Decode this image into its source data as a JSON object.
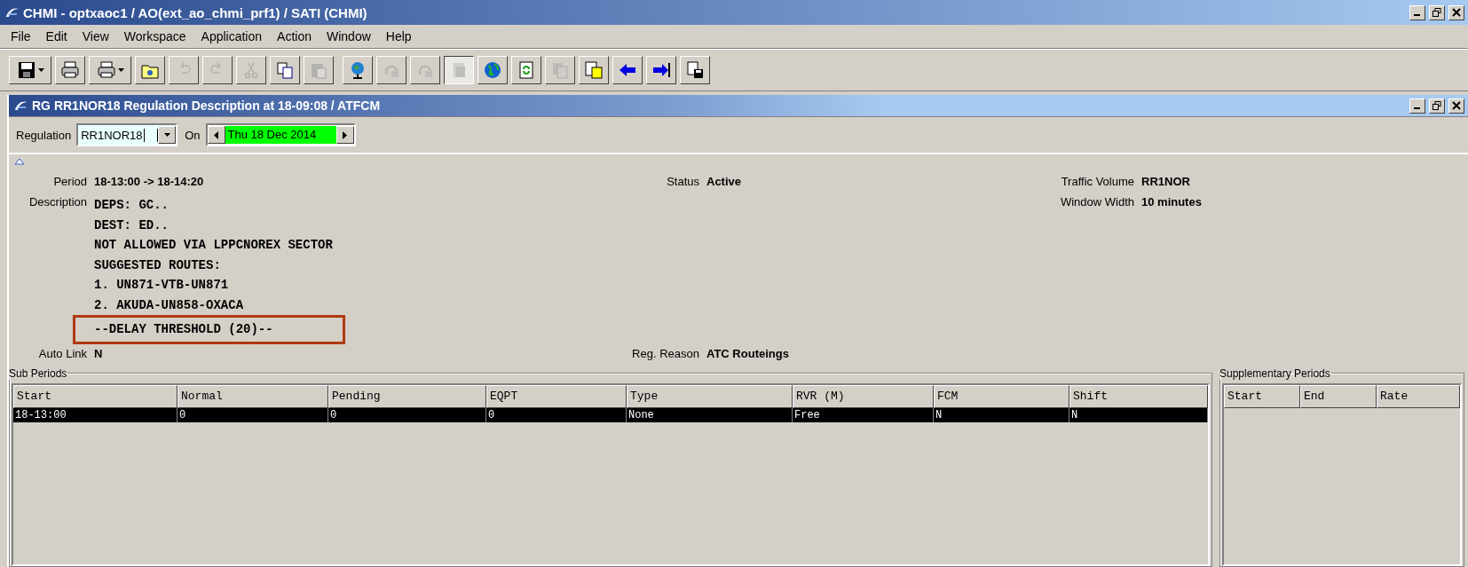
{
  "window": {
    "title": "CHMI - optxaoc1 / AO(ext_ao_chmi_prf1) / SATI (CHMI)"
  },
  "menu": [
    "File",
    "Edit",
    "View",
    "Workspace",
    "Application",
    "Action",
    "Window",
    "Help"
  ],
  "toolbar": [
    {
      "kind": "save",
      "disabled": false,
      "dropdown": true,
      "pressed": false
    },
    {
      "kind": "print",
      "disabled": false,
      "dropdown": false,
      "pressed": false
    },
    {
      "kind": "print",
      "disabled": false,
      "dropdown": true,
      "pressed": false
    },
    {
      "kind": "folder",
      "disabled": false,
      "dropdown": false,
      "pressed": false
    },
    {
      "kind": "undo",
      "disabled": true,
      "dropdown": false,
      "pressed": false
    },
    {
      "kind": "redo",
      "disabled": true,
      "dropdown": false,
      "pressed": false
    },
    {
      "kind": "cut",
      "disabled": true,
      "dropdown": false,
      "pressed": false
    },
    {
      "kind": "copy",
      "disabled": false,
      "dropdown": false,
      "pressed": false
    },
    {
      "kind": "paste",
      "disabled": true,
      "dropdown": false,
      "pressed": false
    },
    {
      "kind": "globe",
      "disabled": false,
      "dropdown": false,
      "pressed": false
    },
    {
      "kind": "rotate",
      "disabled": true,
      "dropdown": false,
      "pressed": false
    },
    {
      "kind": "rotate",
      "disabled": true,
      "dropdown": false,
      "pressed": false
    },
    {
      "kind": "doc",
      "disabled": true,
      "dropdown": false,
      "pressed": true
    },
    {
      "kind": "earth",
      "disabled": false,
      "dropdown": false,
      "pressed": false
    },
    {
      "kind": "reload",
      "disabled": false,
      "dropdown": false,
      "pressed": false
    },
    {
      "kind": "docs",
      "disabled": true,
      "dropdown": false,
      "pressed": false
    },
    {
      "kind": "notes",
      "disabled": false,
      "dropdown": false,
      "pressed": false
    },
    {
      "kind": "left",
      "disabled": false,
      "dropdown": false,
      "pressed": false
    },
    {
      "kind": "right",
      "disabled": false,
      "dropdown": false,
      "pressed": false
    },
    {
      "kind": "savedoc",
      "disabled": false,
      "dropdown": false,
      "pressed": false
    }
  ],
  "inner_window": {
    "title": "RG RR1NOR18 Regulation Description at 18-09:08 / ATFCM"
  },
  "form": {
    "regulation_label": "Regulation",
    "regulation_value": "RR1NOR18",
    "on_label": "On",
    "date": "Thu 18 Dec 2014"
  },
  "details": {
    "period_label": "Period",
    "period": "18-13:00 -> 18-14:20",
    "status_label": "Status",
    "status": "Active",
    "traffic_volume_label": "Traffic Volume",
    "traffic_volume": "RR1NOR",
    "window_width_label": "Window Width",
    "window_width": "10 minutes",
    "description_label": "Description",
    "description": [
      "DEPS: GC..",
      "DEST: ED..",
      "NOT ALLOWED VIA LPPCNOREX SECTOR",
      "SUGGESTED ROUTES:",
      "1. UN871-VTB-UN871",
      "2. AKUDA-UN858-OXACA"
    ],
    "highlighted_line": "--DELAY THRESHOLD (20)--",
    "auto_link_label": "Auto Link",
    "auto_link": "N",
    "reason_label": "Reg. Reason",
    "reason": "ATC Routeings"
  },
  "sub_periods": {
    "title": "Sub Periods",
    "columns": [
      "Start",
      "Normal",
      "Pending",
      "EQPT",
      "Type",
      "RVR (M)",
      "FCM",
      "Shift"
    ],
    "rows": [
      {
        "cells": [
          "18-13:00",
          "0",
          "0",
          "0",
          "None",
          "Free",
          "N",
          "N"
        ],
        "selected": true
      }
    ]
  },
  "supplementary_periods": {
    "title": "Supplementary Periods",
    "columns": [
      "Start",
      "End",
      "Rate"
    ]
  }
}
